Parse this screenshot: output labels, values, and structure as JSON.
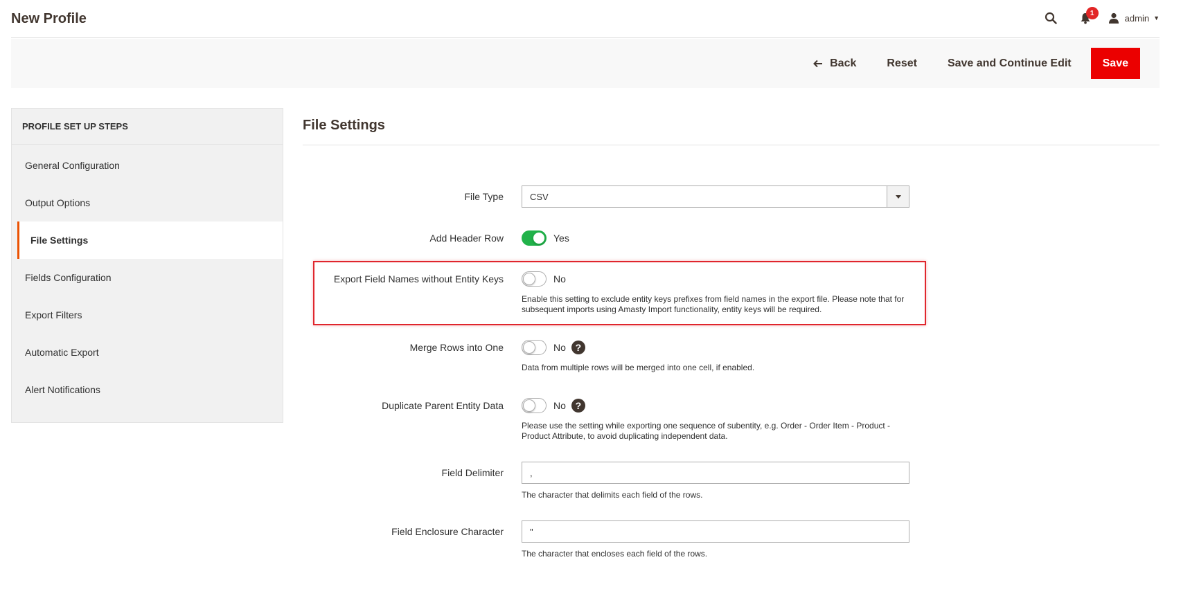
{
  "header": {
    "title": "New Profile",
    "notifications_count": "1",
    "user_name": "admin"
  },
  "actions": {
    "back_label": "Back",
    "reset_label": "Reset",
    "save_continue_label": "Save and Continue Edit",
    "save_label": "Save"
  },
  "steps": {
    "title": "PROFILE SET UP STEPS",
    "items": [
      {
        "label": "General Configuration",
        "active": false
      },
      {
        "label": "Output Options",
        "active": false
      },
      {
        "label": "File Settings",
        "active": true
      },
      {
        "label": "Fields Configuration",
        "active": false
      },
      {
        "label": "Export Filters",
        "active": false
      },
      {
        "label": "Automatic Export",
        "active": false
      },
      {
        "label": "Alert Notifications",
        "active": false
      }
    ]
  },
  "section": {
    "title": "File Settings"
  },
  "fields": {
    "file_type": {
      "label": "File Type",
      "value": "CSV"
    },
    "add_header_row": {
      "label": "Add Header Row",
      "state": "Yes"
    },
    "export_field_names": {
      "label": "Export Field Names without Entity Keys",
      "state": "No",
      "note": "Enable this setting to exclude entity keys prefixes from field names in the export file. Please note that for subsequent imports using Amasty Import functionality, entity keys will be required."
    },
    "merge_rows": {
      "label": "Merge Rows into One",
      "state": "No",
      "note": "Data from multiple rows will be merged into one cell, if enabled."
    },
    "duplicate_parent": {
      "label": "Duplicate Parent Entity Data",
      "state": "No",
      "note": "Please use the setting while exporting one sequence of subentity, e.g. Order - Order Item - Product - Product Attribute, to avoid duplicating independent data."
    },
    "field_delimiter": {
      "label": "Field Delimiter",
      "value": ",",
      "note": "The character that delimits each field of the rows."
    },
    "field_enclosure": {
      "label": "Field Enclosure Character",
      "value": "\"",
      "note": "The character that encloses each field of the rows."
    }
  },
  "help_glyph": "?",
  "colors": {
    "save_button": "#eb0000",
    "toggle_on": "#21b24a",
    "highlight_border": "#e0262d",
    "notification_badge": "#e22626"
  }
}
